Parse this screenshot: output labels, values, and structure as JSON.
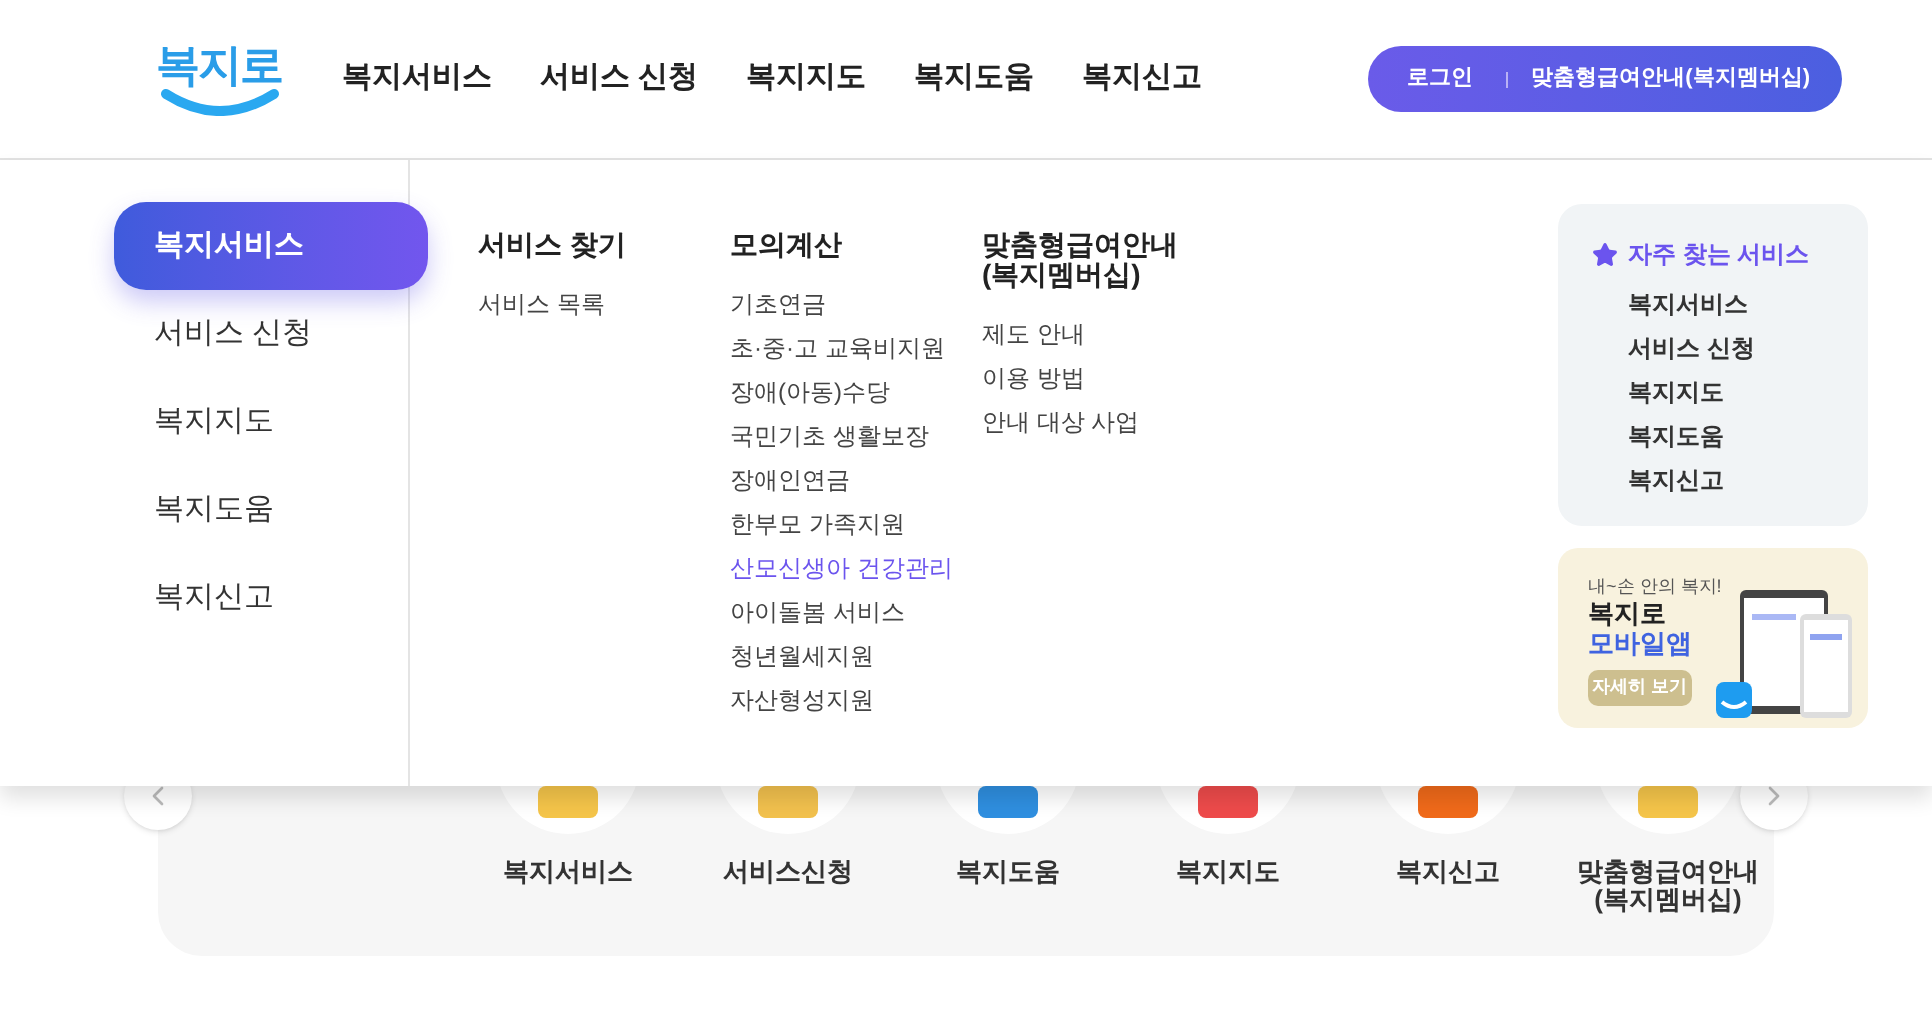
{
  "header": {
    "logo": "복지로",
    "nav": [
      "복지서비스",
      "서비스 신청",
      "복지지도",
      "복지도움",
      "복지신고"
    ],
    "login": "로그인",
    "membership": "맞춤형급여안내(복지멤버십)"
  },
  "menu": {
    "side": [
      {
        "label": "복지서비스",
        "selected": true
      },
      {
        "label": "서비스 신청",
        "selected": false
      },
      {
        "label": "복지지도",
        "selected": false
      },
      {
        "label": "복지도움",
        "selected": false
      },
      {
        "label": "복지신고",
        "selected": false
      }
    ],
    "columns": [
      {
        "title": "서비스 찾기",
        "links": [
          {
            "label": "서비스 목록",
            "highlighted": false
          }
        ]
      },
      {
        "title": "모의계산",
        "links": [
          {
            "label": "기초연금",
            "highlighted": false
          },
          {
            "label": "초·중·고 교육비지원",
            "highlighted": false
          },
          {
            "label": "장애(아동)수당",
            "highlighted": false
          },
          {
            "label": "국민기초 생활보장",
            "highlighted": false
          },
          {
            "label": "장애인연금",
            "highlighted": false
          },
          {
            "label": "한부모 가족지원",
            "highlighted": false
          },
          {
            "label": "산모신생아 건강관리",
            "highlighted": true
          },
          {
            "label": "아이돌봄 서비스",
            "highlighted": false
          },
          {
            "label": "청년월세지원",
            "highlighted": false
          },
          {
            "label": "자산형성지원",
            "highlighted": false
          }
        ]
      },
      {
        "title": "맞춤형급여안내 (복지멤버십)",
        "links": [
          {
            "label": "제도 안내",
            "highlighted": false
          },
          {
            "label": "이용 방법",
            "highlighted": false
          },
          {
            "label": "안내 대상 사업",
            "highlighted": false
          }
        ]
      }
    ],
    "favorites": {
      "title": "자주 찾는 서비스",
      "items": [
        "복지서비스",
        "서비스 신청",
        "복지지도",
        "복지도움",
        "복지신고"
      ]
    },
    "banner": {
      "tagline": "내~손 안의 복지!",
      "title": "복지로",
      "subtitle": "모바일앱",
      "button": "자세히 보기"
    }
  },
  "carousel": {
    "items": [
      {
        "label": "복지서비스",
        "color": "#f5c54a"
      },
      {
        "label": "서비스신청",
        "color": "#f2c14e"
      },
      {
        "label": "복지도움",
        "color": "#2f8fe0"
      },
      {
        "label": "복지지도",
        "color": "#ee4b4b"
      },
      {
        "label": "복지신고",
        "color": "#f06a1a"
      },
      {
        "label": "맞춤형급여안내 (복지멤버십)",
        "color": "#f5c54a"
      }
    ]
  }
}
